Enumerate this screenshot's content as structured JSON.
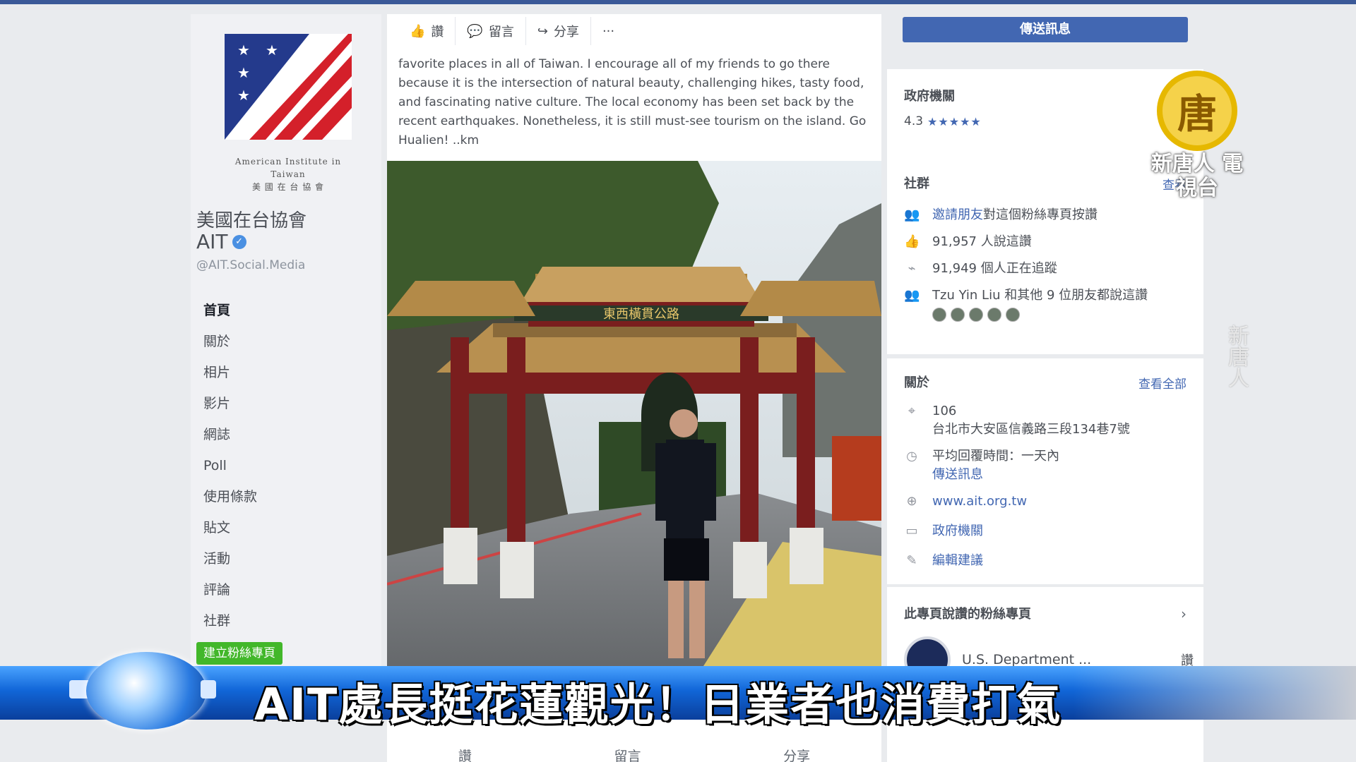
{
  "left": {
    "logo_subtitle_en": "American Institute in Taiwan",
    "logo_subtitle_zh": "美 國 在 台 協 會",
    "page_name_zh": "美國在台協會",
    "page_name_en": "AIT",
    "handle": "@AIT.Social.Media",
    "nav": [
      "首頁",
      "關於",
      "相片",
      "影片",
      "網誌",
      "Poll",
      "使用條款",
      "貼文",
      "活動",
      "評論",
      "社群"
    ],
    "create_page": "建立粉絲專頁"
  },
  "post": {
    "actions": {
      "like": "讚",
      "comment": "留言",
      "share": "分享",
      "more": "···"
    },
    "text": "favorite places in all of Taiwan. I encourage all of my friends to go there because it is the intersection of natural beauty, challenging hikes, tasty food, and fascinating native culture. The local economy has been set back by the recent earthquakes. Nonetheless, it is still must-see tourism on the island. Go Hualien! ..km",
    "gate_sign": "東西橫貫公路",
    "footer": {
      "like": "讚",
      "comment": "留言",
      "share": "分享"
    }
  },
  "right": {
    "message_button": "傳送訊息",
    "category": "政府機關",
    "rating_value": "4.3",
    "rating_stars": "★★★★★",
    "community": {
      "title": "社群",
      "see_all": "查看",
      "invite_link": "邀請朋友",
      "invite_rest": "對這個粉絲專頁按讚",
      "likes": "91,957 人說這讚",
      "follows": "91,949 個人正在追蹤",
      "friends": "Tzu Yin Liu 和其他 9 位朋友都說這讚"
    },
    "about": {
      "title": "關於",
      "see_all": "查看全部",
      "postcode": "106",
      "address": "台北市大安區信義路三段134巷7號",
      "response": "平均回覆時間：一天內",
      "send_message": "傳送訊息",
      "website": "www.ait.org.tw",
      "category": "政府機關",
      "edit": "編輯建議"
    },
    "liked_pages": {
      "title": "此專頁說讚的粉絲專頁",
      "dept": "U.S. Department ...",
      "like": "讚"
    }
  },
  "overlay": {
    "logo_glyph": "唐",
    "logo_text": "新唐人 電視台",
    "watermark": "新唐人",
    "headline": "AIT處長挺花蓮觀光！日業者也消費打氣"
  },
  "colors": {
    "facebook_blue": "#4267b2",
    "news_blue": "#1166d8",
    "logo_gold": "#e6b800"
  }
}
